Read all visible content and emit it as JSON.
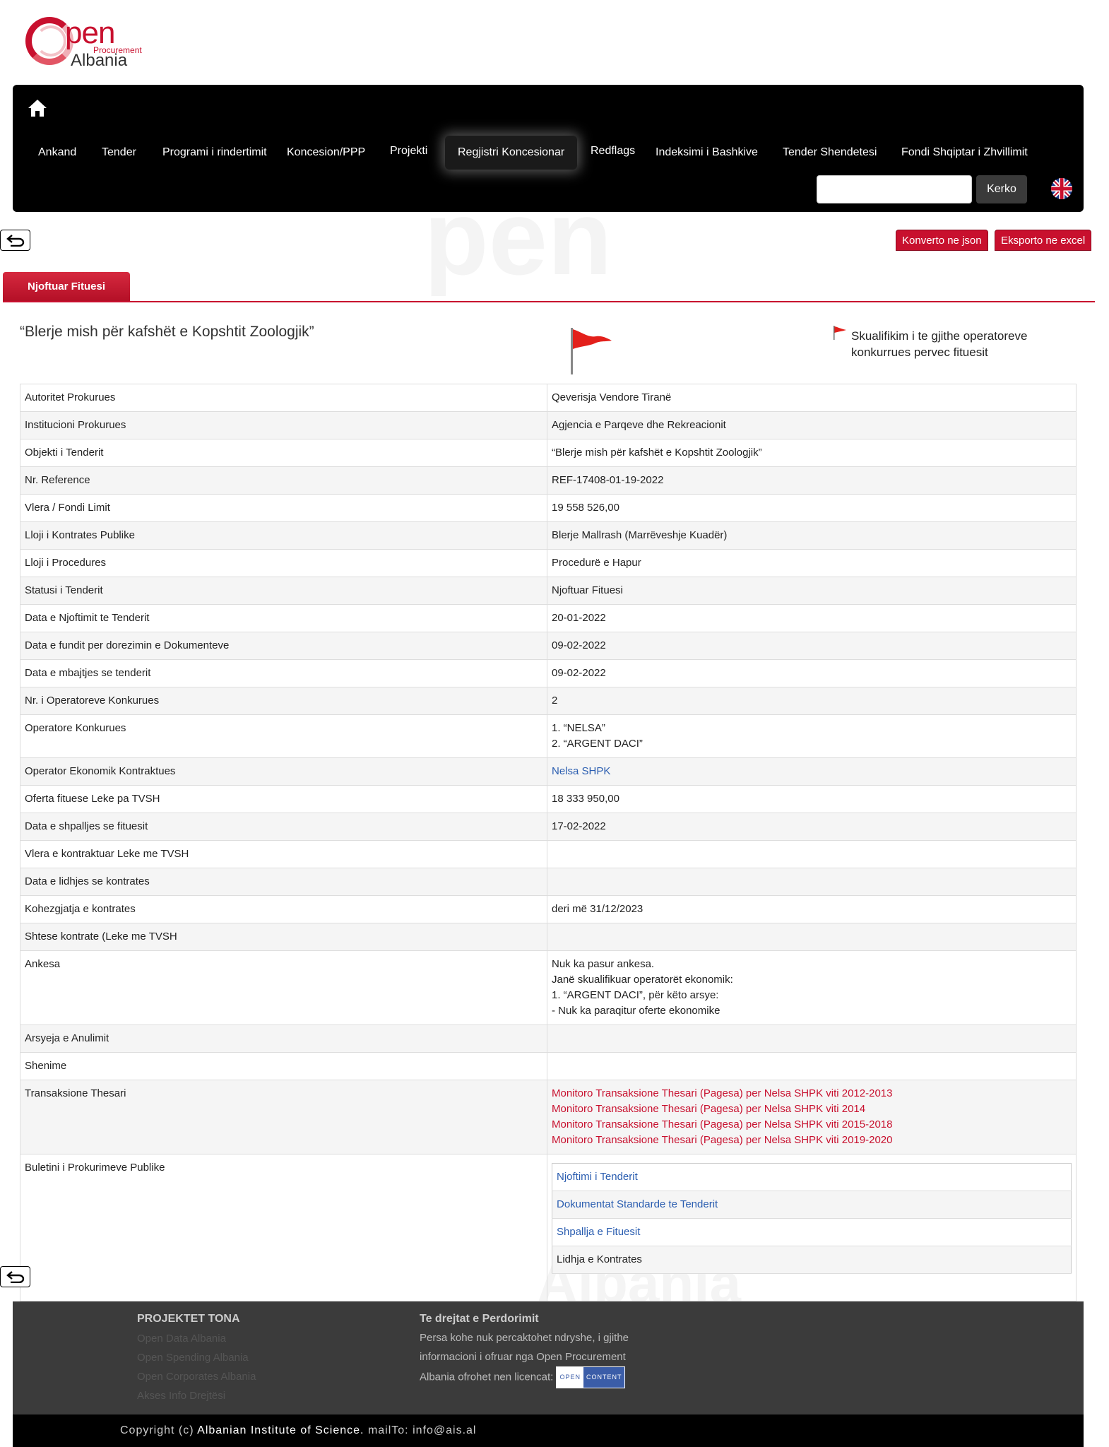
{
  "logo": {
    "word": "pen",
    "sub": "Procurement",
    "country": "Albania"
  },
  "nav": {
    "items": [
      "Ankand",
      "Tender",
      "Programi i rindertimit",
      "Koncesion/PPP",
      "Projekti",
      "Regjistri Koncesionar",
      "Redflags",
      "Indeksimi i Bashkive",
      "Tender Shendetesi",
      "Fondi Shqiptar i Zhvillimit"
    ],
    "active": "Regjistri Koncesionar",
    "search_placeholder": "",
    "search_label": "Kerko"
  },
  "watermark": {
    "top": "pen",
    "bottom": "Albania"
  },
  "actions": {
    "json": "Konverto ne json",
    "excel": "Eksporto ne excel"
  },
  "tab": "Njoftuar Fituesi",
  "title": "“Blerje mish për kafshët e Kopshtit Zoologjik”",
  "disq_note": "Skualifikim i te gjithe operatoreve konkurrues pervec fituesit",
  "details": [
    {
      "k": "Autoritet Prokurues",
      "v": [
        "Qeverisja Vendore Tiranë"
      ]
    },
    {
      "k": "Institucioni Prokurues",
      "v": [
        "Agjencia e Parqeve dhe Rekreacionit"
      ]
    },
    {
      "k": "Objekti i Tenderit",
      "v": [
        "“Blerje mish për kafshët e Kopshtit Zoologjik”"
      ]
    },
    {
      "k": "Nr. Reference",
      "v": [
        "REF-17408-01-19-2022"
      ]
    },
    {
      "k": "Vlera / Fondi Limit",
      "v": [
        "19 558 526,00"
      ]
    },
    {
      "k": "Lloji i Kontrates Publike",
      "v": [
        "Blerje Mallrash (Marrëveshje Kuadër)"
      ]
    },
    {
      "k": "Lloji i Procedures",
      "v": [
        "Procedurë e Hapur"
      ]
    },
    {
      "k": "Statusi i Tenderit",
      "v": [
        "Njoftuar Fituesi"
      ]
    },
    {
      "k": "Data e Njoftimit te Tenderit",
      "v": [
        "20-01-2022"
      ]
    },
    {
      "k": "Data e fundit per dorezimin e Dokumenteve",
      "v": [
        "09-02-2022"
      ]
    },
    {
      "k": "Data e mbajtjes se tenderit",
      "v": [
        "09-02-2022"
      ]
    },
    {
      "k": "Nr. i Operatoreve Konkurues",
      "v": [
        "2"
      ]
    },
    {
      "k": "Operatore Konkurues",
      "v": [
        "1. “NELSA”",
        "2. “ARGENT DACI”"
      ]
    },
    {
      "k": "Operator Ekonomik Kontraktues",
      "v": [
        "Nelsa SHPK"
      ],
      "link": "blue"
    },
    {
      "k": "Oferta fituese Leke pa TVSH",
      "v": [
        "18 333 950,00"
      ]
    },
    {
      "k": "Data e shpalljes se fituesit",
      "v": [
        "17-02-2022"
      ]
    },
    {
      "k": "Vlera e kontraktuar Leke me TVSH",
      "v": []
    },
    {
      "k": "Data e lidhjes se kontrates",
      "v": []
    },
    {
      "k": "Kohezgjatja e kontrates",
      "v": [
        "deri më 31/12/2023"
      ]
    },
    {
      "k": "Shtese kontrate (Leke me TVSH",
      "v": []
    },
    {
      "k": "Ankesa",
      "v": [
        "Nuk ka pasur ankesa.",
        "Janë skualifikuar operatorët ekonomik:",
        "1. “ARGENT DACI”, për këto arsye:",
        "- Nuk ka paraqitur oferte ekonomike"
      ]
    },
    {
      "k": "Arsyeja e Anulimit",
      "v": []
    },
    {
      "k": "Shenime",
      "v": []
    },
    {
      "k": "Transaksione Thesari",
      "v": [
        "Monitoro Transaksione Thesari (Pagesa) per Nelsa SHPK viti 2012-2013",
        "Monitoro Transaksione Thesari (Pagesa) per Nelsa SHPK viti 2014",
        "Monitoro Transaksione Thesari (Pagesa) per Nelsa SHPK viti 2015-2018",
        "Monitoro Transaksione Thesari (Pagesa) per Nelsa SHPK viti 2019-2020"
      ],
      "link": "red"
    }
  ],
  "bulletin": {
    "label": "Buletini i Prokurimeve Publike",
    "items": [
      {
        "text": "Njoftimi i Tenderit",
        "link": true
      },
      {
        "text": "Dokumentat Standarde te Tenderit",
        "link": true
      },
      {
        "text": "Shpallja e Fituesit",
        "link": true
      },
      {
        "text": "Lidhja e Kontrates",
        "link": false
      }
    ]
  },
  "footer": {
    "projects_title": "PROJEKTET TONA",
    "projects": [
      "Open Data Albania",
      "Open Spending Albania",
      "Open Corporates Albania",
      "Akses Info Drejtësi"
    ],
    "rights_title": "Te drejtat e Perdorimit",
    "rights_lines": [
      "Persa kohe nuk percaktohet ndryshe, i gjithe",
      "informacioni i ofruar nga Open Procurement",
      "Albania ofrohet nen licencat:"
    ],
    "badge": [
      "OPEN",
      "CONTENT"
    ]
  },
  "copyright": {
    "prefix": "Copyright (c) ",
    "org": "Albanian Institute of Science.",
    "mail_label": " mailTo: ",
    "mail": "info@ais.al"
  }
}
